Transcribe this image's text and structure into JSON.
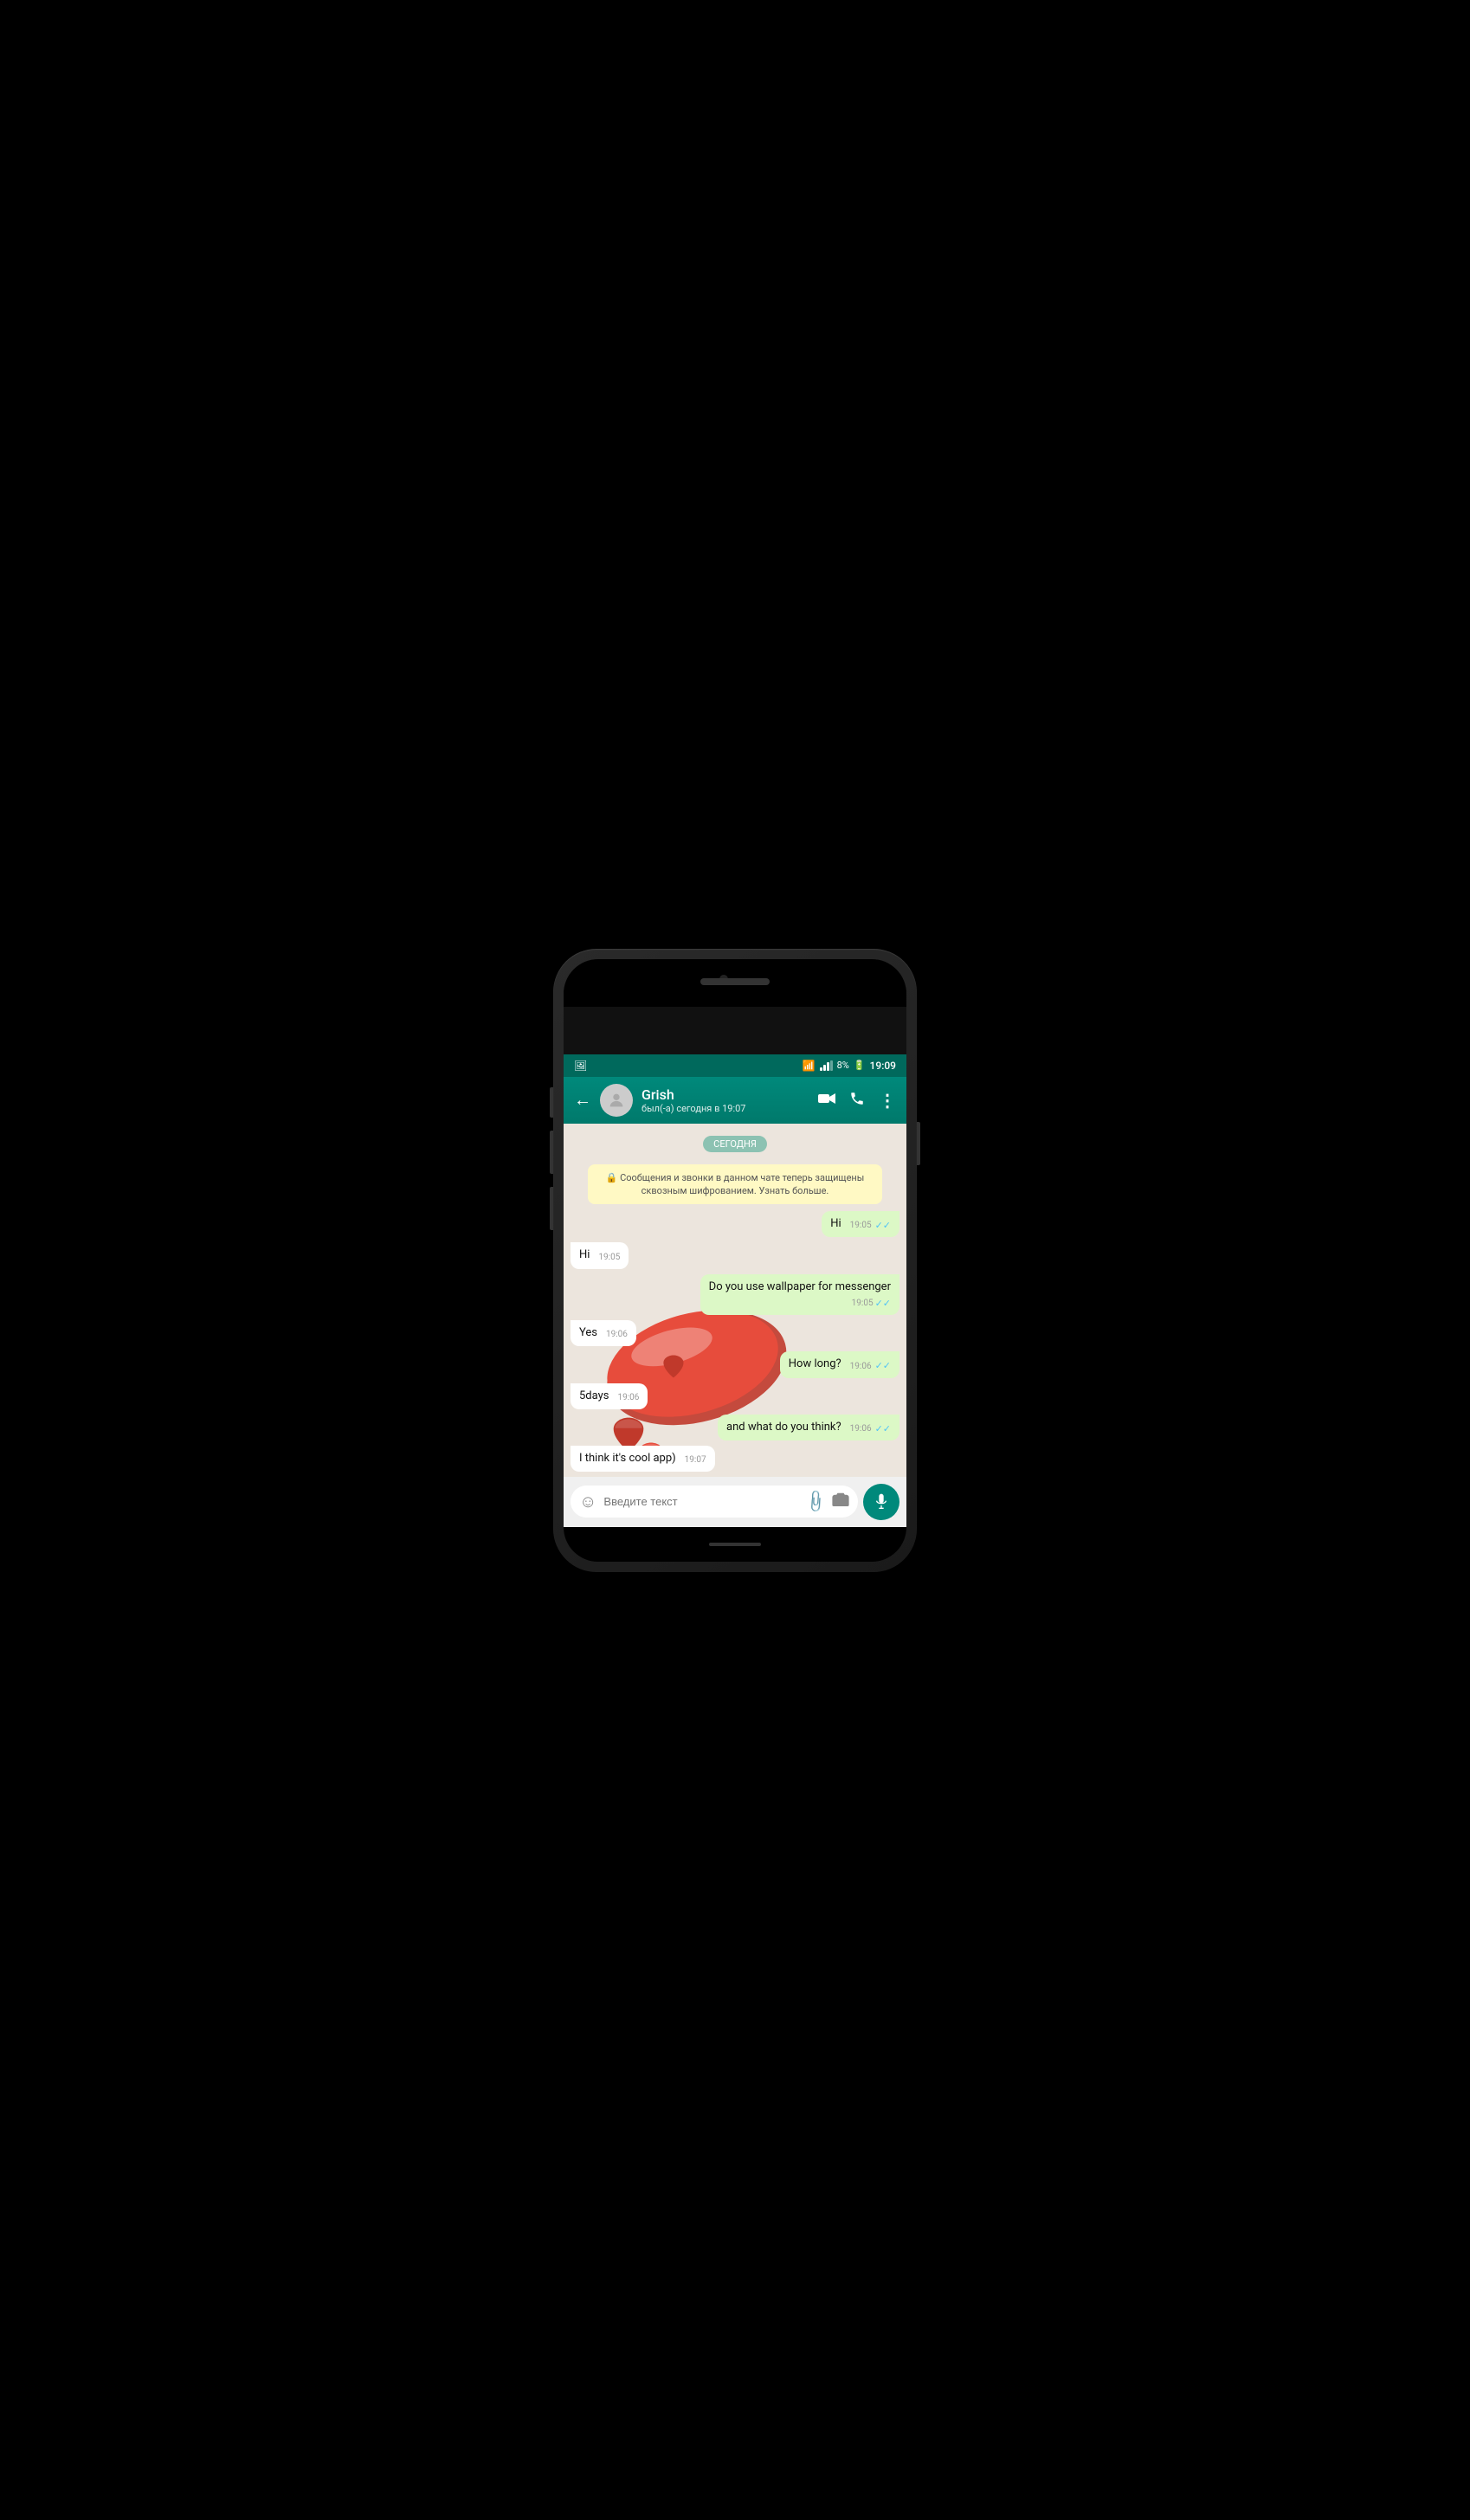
{
  "phone": {
    "statusBar": {
      "time": "19:09",
      "battery": "8%",
      "wifiLabel": "wifi",
      "signalLabel": "signal"
    },
    "header": {
      "backLabel": "←",
      "contactName": "Grish",
      "contactStatus": "был(-а) сегодня в 19:07",
      "videoCallIcon": "📹",
      "callIcon": "📞",
      "menuIcon": "⋮"
    },
    "chat": {
      "dateBadge": "СЕГОДНЯ",
      "encryptionNotice": "🔒 Сообщения и звонки в данном чате теперь защищены сквозным шифрованием. Узнать больше.",
      "messages": [
        {
          "id": "msg1",
          "type": "sent",
          "text": "Hi",
          "time": "19:05",
          "status": "read"
        },
        {
          "id": "msg2",
          "type": "received",
          "text": "Hi",
          "time": "19:05",
          "status": null
        },
        {
          "id": "msg3",
          "type": "sent",
          "text": "Do you use wallpaper for messenger",
          "time": "19:05",
          "status": "read"
        },
        {
          "id": "msg4",
          "type": "received",
          "text": "Yes",
          "time": "19:06",
          "status": null
        },
        {
          "id": "msg5",
          "type": "sent",
          "text": "How long?",
          "time": "19:06",
          "status": "read"
        },
        {
          "id": "msg6",
          "type": "received",
          "text": "5days",
          "time": "19:06",
          "status": null
        },
        {
          "id": "msg7",
          "type": "sent",
          "text": "and what do you think?",
          "time": "19:06",
          "status": "read"
        },
        {
          "id": "msg8",
          "type": "received",
          "text": "I think it's cool app)",
          "time": "19:07",
          "status": null
        }
      ]
    },
    "inputBar": {
      "placeholder": "Введите текст"
    }
  }
}
